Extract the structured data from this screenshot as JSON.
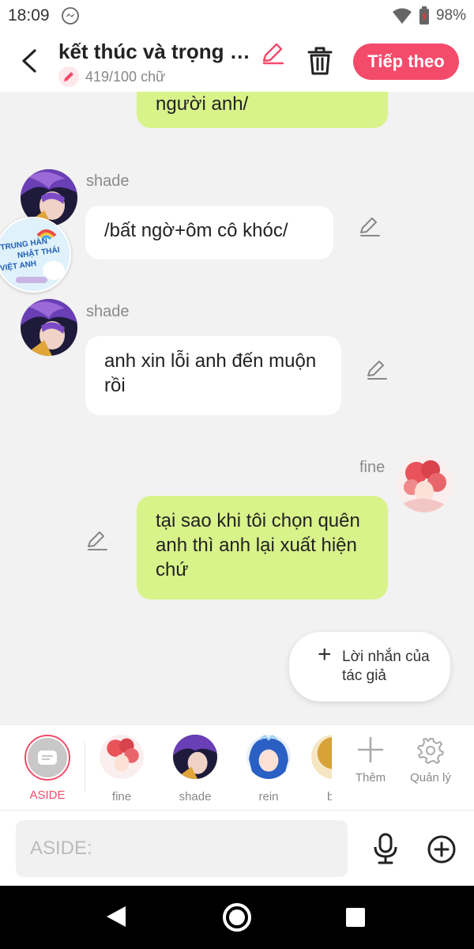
{
  "status": {
    "time": "18:09",
    "battery": "98%"
  },
  "header": {
    "title": "kết thúc và trọng si…",
    "word_count": "419/100 chữ",
    "next_label": "Tiếp theo"
  },
  "messages": [
    {
      "side": "right",
      "text": "người anh/"
    },
    {
      "side": "left",
      "name": "shade",
      "text": "/bất ngờ+ôm cô khóc/"
    },
    {
      "side": "left",
      "name": "shade",
      "text": "anh xin lỗi anh đến muộn rồi"
    },
    {
      "side": "right",
      "name": "fine",
      "text": "tại sao khi tôi chọn quên anh thì anh lại xuất hiện chứ"
    }
  ],
  "sticker": {
    "line1": "TRUNG HÀN",
    "line2": "NHẬT THÁI",
    "line3": "VIỆT ANH"
  },
  "author_note": {
    "label": "Lời nhắn của tác giả"
  },
  "characters": [
    {
      "label": "ASIDE"
    },
    {
      "label": "fine"
    },
    {
      "label": "shade"
    },
    {
      "label": "rein"
    },
    {
      "label": "b"
    }
  ],
  "actions": {
    "add_label": "Thêm",
    "manage_label": "Quản lý"
  },
  "input": {
    "placeholder": "ASIDE:"
  },
  "colors": {
    "accent": "#f44b6b",
    "bubble_right": "#d8f38a",
    "bubble_left": "#ffffff"
  }
}
